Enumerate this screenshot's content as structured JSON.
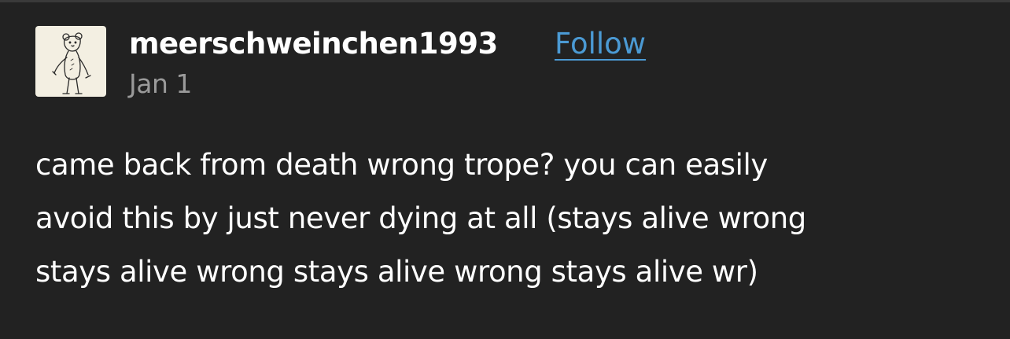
{
  "post": {
    "author": {
      "username": "meerschweinchen1993",
      "avatar_icon": "teddy-bear-sketch-avatar"
    },
    "follow_label": "Follow",
    "date": "Jan 1",
    "body_lines": [
      "came back from death wrong trope? you can easily",
      "avoid this by just never dying at all (stays alive wrong",
      "stays alive wrong stays alive wrong stays alive wr)"
    ]
  },
  "colors": {
    "background": "#222222",
    "text": "#ffffff",
    "link": "#4b9ad4",
    "muted": "#9a9a9a",
    "avatar_bg": "#f3efe2"
  }
}
